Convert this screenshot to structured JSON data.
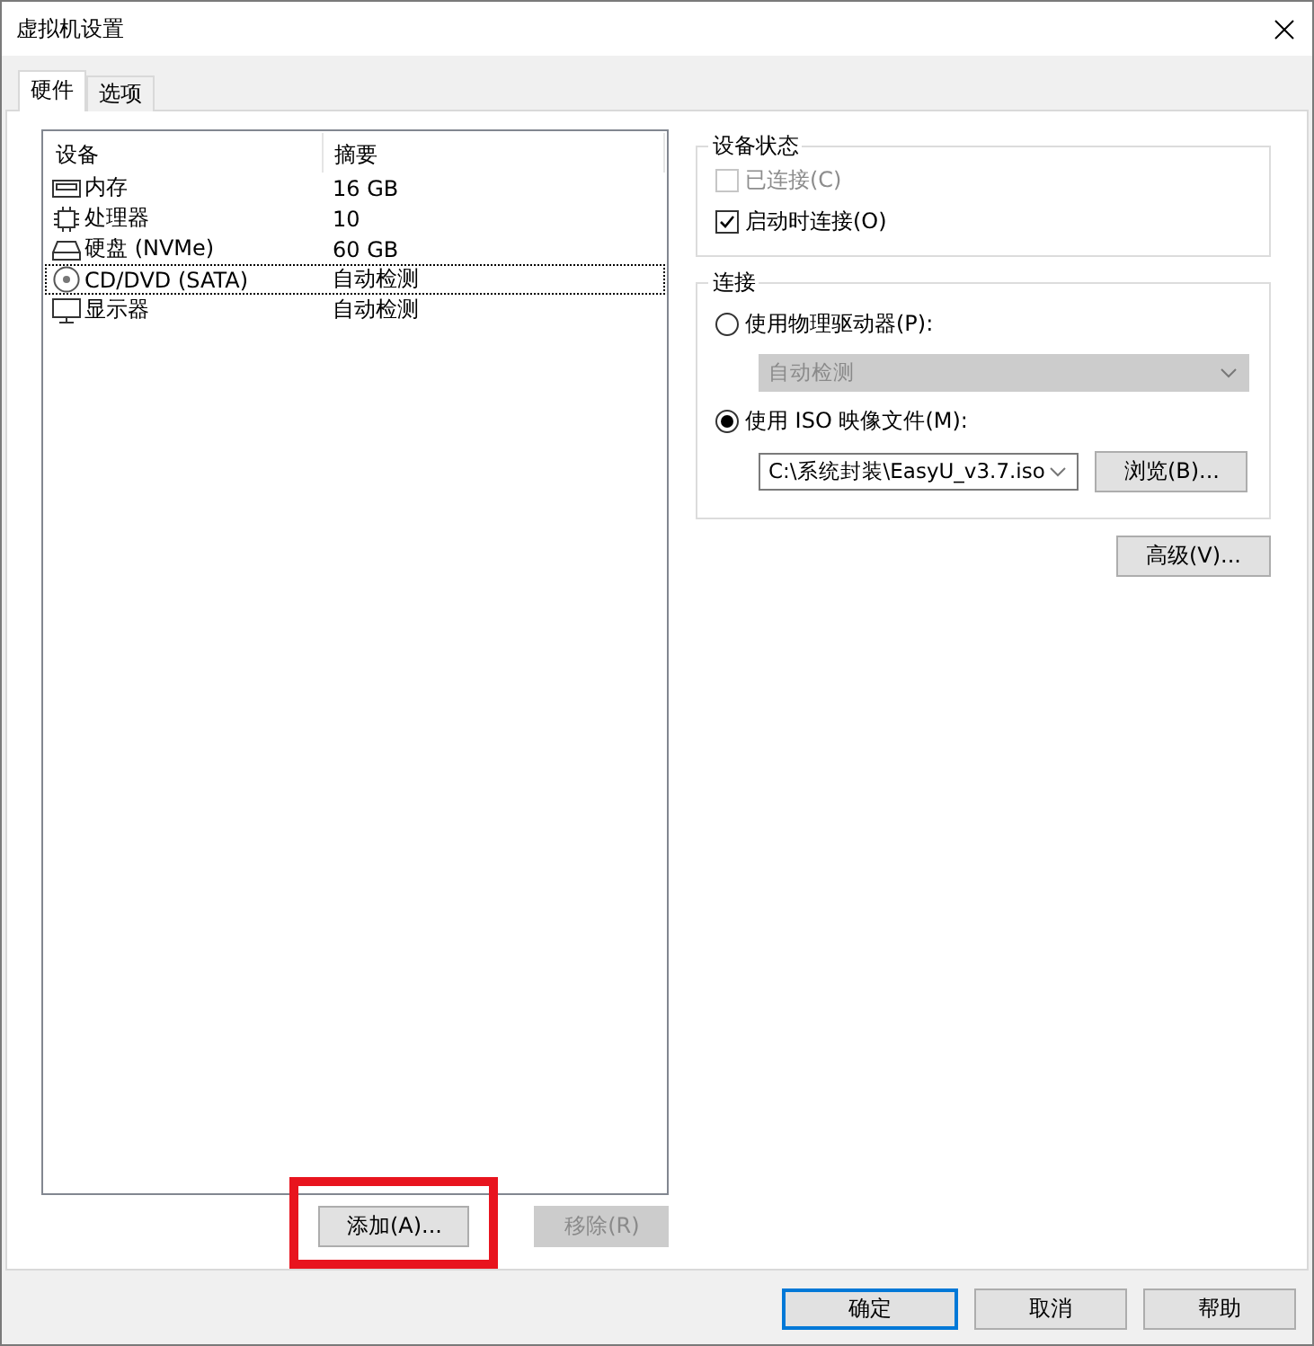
{
  "window": {
    "title": "虚拟机设置"
  },
  "tabs": [
    {
      "label": "硬件",
      "selected": true
    },
    {
      "label": "选项",
      "selected": false
    }
  ],
  "device_table": {
    "columns": [
      "设备",
      "摘要"
    ],
    "rows": [
      {
        "kind": "memory",
        "device": "内存",
        "summary": "16 GB",
        "focused": false
      },
      {
        "kind": "cpu",
        "device": "处理器",
        "summary": "10",
        "focused": false
      },
      {
        "kind": "disk",
        "device": "硬盘 (NVMe)",
        "summary": "60 GB",
        "focused": false
      },
      {
        "kind": "cd",
        "device": "CD/DVD (SATA)",
        "summary": "自动检测",
        "focused": true
      },
      {
        "kind": "display",
        "device": "显示器",
        "summary": "自动检测",
        "focused": false
      }
    ]
  },
  "list_buttons": [
    {
      "label": "添加(A)...",
      "disabled": false,
      "annotated": true
    },
    {
      "label": "移除(R)",
      "disabled": true,
      "annotated": false
    }
  ],
  "device_status": {
    "title": "设备状态",
    "options": [
      {
        "label": "已连接(C)",
        "checked": false,
        "disabled": true
      },
      {
        "label": "启动时连接(O)",
        "checked": true,
        "disabled": false
      }
    ]
  },
  "connection": {
    "title": "连接",
    "options": [
      {
        "label": "使用物理驱动器(P):",
        "selected": false,
        "dropdown": {
          "value": "自动检测",
          "disabled": true
        }
      },
      {
        "label": "使用 ISO 映像文件(M):",
        "selected": true,
        "dropdown": {
          "value": "C:\\系统封装\\EasyU_v3.7.iso",
          "disabled": false
        },
        "button": "浏览(B)..."
      }
    ]
  },
  "advanced_button": "高级(V)...",
  "dialog_buttons": [
    {
      "label": "确定",
      "default": true
    },
    {
      "label": "取消",
      "default": false
    },
    {
      "label": "帮助",
      "default": false
    }
  ]
}
